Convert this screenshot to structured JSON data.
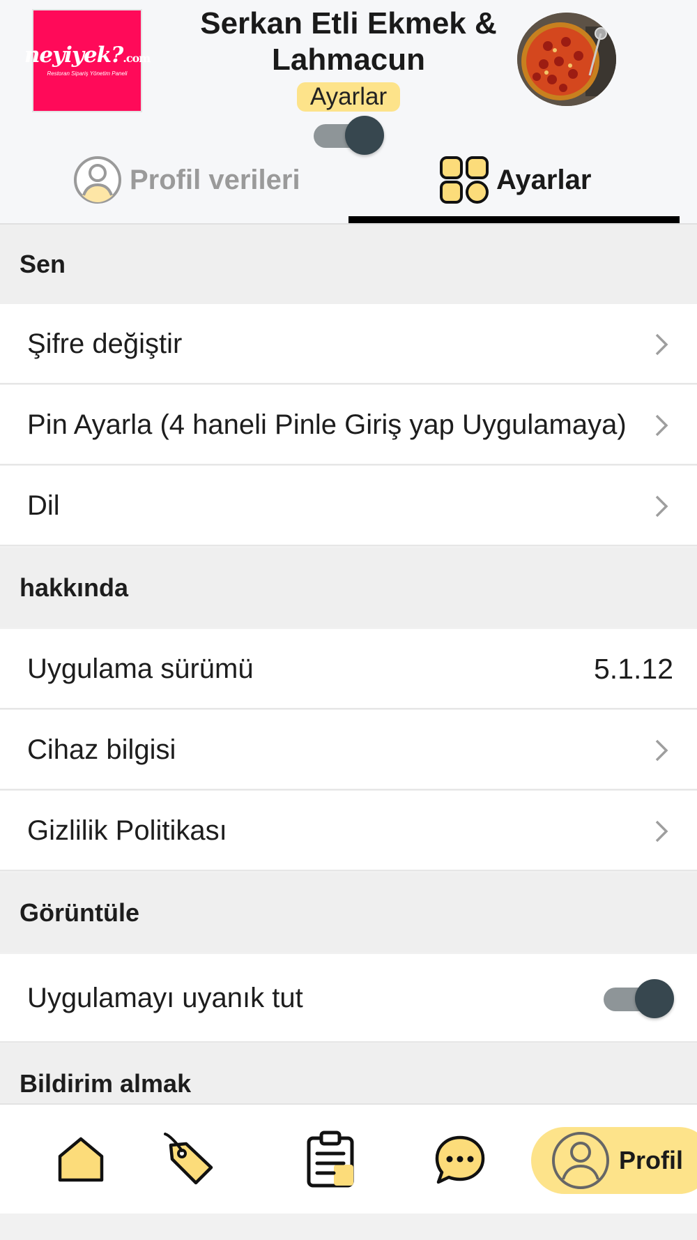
{
  "header": {
    "logo": {
      "brand_main": "neyiyek?",
      "brand_suffix": ".com",
      "brand_tagline": "Restoran Sipariş Yönetim Paneli"
    },
    "restaurant_name": "Serkan Etli Ekmek & Lahmacun",
    "page_badge": "Ayarlar",
    "toggle_on": true
  },
  "tabs": [
    {
      "label": "Profil verileri",
      "icon": "user-circle-icon",
      "active": false
    },
    {
      "label": "Ayarlar",
      "icon": "grid-icon",
      "active": true
    }
  ],
  "sections": {
    "you": {
      "title": "Sen",
      "items": [
        {
          "label": "Şifre değiştir"
        },
        {
          "label": "Pin Ayarla (4 haneli Pinle Giriş yap Uygulamaya)"
        },
        {
          "label": "Dil"
        }
      ]
    },
    "about": {
      "title": "hakkında",
      "items": [
        {
          "label": "Uygulama sürümü",
          "value": "5.1.12"
        },
        {
          "label": "Cihaz bilgisi"
        },
        {
          "label": "Gizlilik Politikası"
        }
      ]
    },
    "display": {
      "title": "Görüntüle",
      "items": [
        {
          "label": "Uygulamayı uyanık tut",
          "toggle_on": true
        }
      ]
    },
    "notifications": {
      "title": "Bildirim almak"
    }
  },
  "bottom_nav": {
    "items": [
      {
        "icon": "home-icon"
      },
      {
        "icon": "tag-icon"
      },
      {
        "icon": "clipboard-icon"
      },
      {
        "icon": "chat-icon"
      },
      {
        "icon": "user-circle-icon",
        "label": "Profil",
        "active": true
      }
    ]
  },
  "colors": {
    "accent_yellow": "#fde38a",
    "icon_yellow": "#fcdc7a",
    "toggle_knob": "#37474f",
    "toggle_track": "#8e9598",
    "logo_pink": "#ff0a59"
  }
}
